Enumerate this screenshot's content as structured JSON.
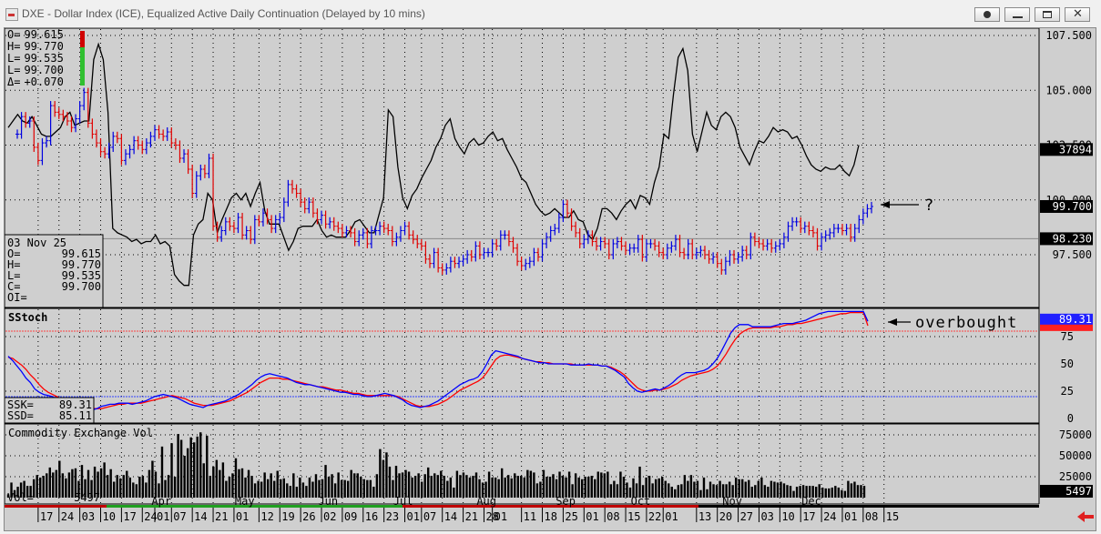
{
  "window": {
    "title": "DXE - Dollar Index (ICE), Equalized Active Daily Continuation (Delayed by 10 mins)"
  },
  "ohlc_readout": [
    {
      "k": "O=",
      "v": "99.615"
    },
    {
      "k": "H=",
      "v": "99.770"
    },
    {
      "k": "L=",
      "v": "99.535"
    },
    {
      "k": "L=",
      "v": "99.700"
    },
    {
      "k": "Δ=",
      "v": "+0.070"
    }
  ],
  "data_box": {
    "date": "03 Nov 25",
    "rows": [
      {
        "k": "O=",
        "v": "99.615"
      },
      {
        "k": "H=",
        "v": "99.770"
      },
      {
        "k": "L=",
        "v": "99.535"
      },
      {
        "k": "C=",
        "v": "99.700"
      },
      {
        "k": "OI=",
        "v": ""
      }
    ]
  },
  "price_panel": {
    "axis_ticks": [
      "107.500",
      "105.000",
      "102.500",
      "100.000",
      "97.500"
    ],
    "axis_tick_values": [
      107.5,
      105.0,
      102.5,
      100.0,
      97.5
    ],
    "tags": [
      {
        "text": "37894",
        "value": 102.3,
        "bg": "#000000",
        "fg": "#ffffff"
      },
      {
        "text": "99.700",
        "value": 99.7,
        "bg": "#000000",
        "fg": "#ffffff"
      },
      {
        "text": "98.230",
        "value": 98.23,
        "bg": "#000000",
        "fg": "#ffffff"
      }
    ],
    "annotation": "?"
  },
  "stoch_panel": {
    "title": "SStoch",
    "axis_ticks": [
      "75",
      "50",
      "25",
      "0"
    ],
    "axis_tick_values": [
      75,
      50,
      25,
      0
    ],
    "tag_top": "89.31",
    "annotation": "overbought",
    "ssk_label": "SSK=",
    "ssk_value": "89.31",
    "ssd_label": "SSD=",
    "ssd_value": "85.11"
  },
  "vol_panel": {
    "title": "Commodity Exchange Vol",
    "axis_ticks": [
      "75000",
      "50000",
      "25000"
    ],
    "axis_tick_values": [
      75000,
      50000,
      25000
    ],
    "tag": "5497",
    "vol_label": "Vol=",
    "vol_value": "5497"
  },
  "date_axis": {
    "months": [
      {
        "label": "Apr",
        "i": 32
      },
      {
        "label": "May",
        "i": 52
      },
      {
        "label": "Jun",
        "i": 72
      },
      {
        "label": "Jul",
        "i": 90
      },
      {
        "label": "Aug",
        "i": 110
      },
      {
        "label": "Sep",
        "i": 129
      },
      {
        "label": "Oct",
        "i": 147
      },
      {
        "label": "Nov",
        "i": 169
      },
      {
        "label": "Dec",
        "i": 188
      }
    ],
    "days": [
      {
        "label": "17",
        "i": 5
      },
      {
        "label": "24",
        "i": 10
      },
      {
        "label": "03",
        "i": 15
      },
      {
        "label": "10",
        "i": 20
      },
      {
        "label": "17",
        "i": 25
      },
      {
        "label": "24",
        "i": 30
      },
      {
        "label": "01",
        "i": 33
      },
      {
        "label": "07",
        "i": 37
      },
      {
        "label": "14",
        "i": 42
      },
      {
        "label": "21",
        "i": 47
      },
      {
        "label": "01",
        "i": 52
      },
      {
        "label": "12",
        "i": 58
      },
      {
        "label": "19",
        "i": 63
      },
      {
        "label": "26",
        "i": 68
      },
      {
        "label": "02",
        "i": 73
      },
      {
        "label": "09",
        "i": 78
      },
      {
        "label": "16",
        "i": 83
      },
      {
        "label": "23",
        "i": 88
      },
      {
        "label": "01",
        "i": 93
      },
      {
        "label": "07",
        "i": 97
      },
      {
        "label": "14",
        "i": 102
      },
      {
        "label": "21",
        "i": 107
      },
      {
        "label": "28",
        "i": 112
      },
      {
        "label": "01",
        "i": 114
      },
      {
        "label": "11",
        "i": 121
      },
      {
        "label": "18",
        "i": 126
      },
      {
        "label": "25",
        "i": 131
      },
      {
        "label": "01",
        "i": 136
      },
      {
        "label": "08",
        "i": 141
      },
      {
        "label": "15",
        "i": 146
      },
      {
        "label": "22",
        "i": 151
      },
      {
        "label": "01",
        "i": 155
      },
      {
        "label": "13",
        "i": 163
      },
      {
        "label": "20",
        "i": 168
      },
      {
        "label": "27",
        "i": 173
      },
      {
        "label": "03",
        "i": 178
      },
      {
        "label": "10",
        "i": 183
      },
      {
        "label": "17",
        "i": 188
      },
      {
        "label": "24",
        "i": 193
      },
      {
        "label": "01",
        "i": 198
      },
      {
        "label": "08",
        "i": 203
      },
      {
        "label": "15",
        "i": 208
      }
    ]
  },
  "chart_data": {
    "type": "line",
    "colors": {
      "up": "#0000e0",
      "down": "#e00000",
      "line": "#000000",
      "ssk": "#0000ff",
      "ssd": "#ff0000",
      "volume": "#000000"
    },
    "overbought_level": 80,
    "oversold_level": 20,
    "ref_price": 98.23,
    "closes": [
      103.0,
      103.8,
      103.5,
      103.6,
      102.4,
      101.8,
      102.6,
      102.7,
      104.3,
      104.0,
      103.9,
      103.8,
      103.6,
      103.3,
      103.7,
      104.3,
      104.9,
      103.5,
      103.0,
      102.6,
      102.2,
      102.1,
      102.4,
      102.9,
      102.8,
      101.8,
      102.1,
      102.3,
      102.7,
      102.5,
      102.3,
      102.6,
      102.9,
      103.2,
      103.0,
      102.9,
      103.1,
      102.6,
      102.5,
      101.9,
      102.1,
      101.4,
      100.3,
      101.1,
      101.4,
      101.2,
      101.9,
      98.8,
      98.3,
      98.6,
      99.0,
      98.8,
      98.7,
      99.2,
      98.4,
      98.6,
      98.2,
      99.1,
      99.0,
      99.4,
      99.1,
      98.7,
      99.1,
      99.2,
      99.9,
      100.7,
      100.5,
      100.3,
      99.9,
      99.6,
      99.9,
      99.4,
      99.1,
      99.3,
      98.9,
      99.0,
      98.8,
      98.7,
      98.5,
      98.6,
      98.5,
      98.1,
      98.4,
      98.5,
      98.0,
      98.6,
      98.6,
      98.8,
      98.7,
      98.6,
      98.1,
      98.3,
      98.6,
      98.8,
      98.4,
      98.2,
      98.0,
      97.9,
      97.3,
      97.1,
      97.6,
      96.9,
      96.8,
      96.9,
      97.2,
      97.1,
      97.2,
      97.3,
      97.5,
      97.4,
      97.9,
      97.5,
      97.6,
      97.6,
      98.0,
      97.9,
      98.4,
      98.4,
      98.1,
      97.8,
      97.2,
      97.0,
      97.1,
      97.2,
      97.6,
      97.4,
      98.0,
      98.3,
      98.6,
      98.7,
      99.2,
      99.8,
      99.4,
      98.8,
      98.5,
      98.0,
      98.2,
      98.4,
      98.1,
      97.9,
      98.1,
      98.0,
      97.5,
      98.0,
      98.1,
      97.9,
      97.7,
      97.8,
      97.8,
      98.2,
      97.4,
      98.0,
      98.0,
      97.9,
      97.6,
      97.5,
      97.8,
      97.9,
      98.2,
      97.6,
      97.5,
      98.0,
      97.5,
      97.6,
      97.7,
      97.5,
      97.3,
      97.4,
      97.1,
      96.8,
      97.2,
      97.5,
      97.3,
      97.4,
      97.7,
      97.5,
      98.3,
      98.1,
      98.0,
      97.9,
      98.0,
      97.8,
      97.9,
      98.0,
      98.3,
      98.8,
      99.0,
      99.0,
      98.7,
      98.8,
      98.6,
      98.5,
      97.9,
      98.3,
      98.4,
      98.5,
      98.7,
      98.7,
      98.6,
      98.7,
      98.3,
      98.7,
      99.1,
      99.4,
      99.6,
      99.7
    ],
    "ohlc_range_half": 0.35,
    "line_series": [
      103.3,
      103.6,
      103.9,
      103.6,
      103.5,
      103.8,
      103.4,
      103.0,
      102.9,
      102.9,
      103.1,
      103.3,
      103.8,
      104.0,
      103.4,
      103.5,
      103.6,
      103.6,
      106.4,
      107.1,
      106.4,
      104.0,
      98.7,
      98.5,
      98.4,
      98.3,
      98.1,
      98.2,
      98.0,
      98.1,
      98.1,
      98.4,
      98.0,
      98.1,
      97.9,
      96.6,
      96.3,
      96.1,
      96.1,
      98.4,
      98.9,
      99.1,
      100.3,
      100.0,
      98.5,
      99.1,
      99.6,
      100.1,
      100.3,
      100.0,
      100.3,
      99.7,
      100.3,
      100.8,
      99.5,
      98.9,
      98.9,
      98.9,
      98.3,
      97.7,
      98.1,
      98.7,
      98.8,
      98.8,
      98.8,
      99.1,
      98.6,
      98.3,
      98.4,
      98.3,
      98.3,
      98.3,
      98.6,
      99.0,
      99.1,
      98.8,
      98.5,
      98.5,
      99.3,
      100.1,
      104.1,
      103.8,
      101.5,
      100.1,
      99.6,
      100.2,
      100.5,
      101.0,
      101.4,
      101.8,
      102.4,
      102.8,
      103.4,
      103.7,
      102.8,
      102.4,
      102.1,
      102.6,
      102.8,
      102.5,
      102.6,
      102.9,
      103.1,
      102.7,
      102.8,
      102.3,
      101.9,
      101.5,
      101.0,
      100.8,
      100.3,
      99.8,
      99.5,
      99.3,
      99.4,
      99.6,
      99.4,
      99.2,
      99.2,
      99.5,
      99.1,
      99.0,
      98.4,
      98.2,
      98.7,
      99.6,
      99.6,
      99.4,
      99.1,
      99.5,
      99.8,
      100.0,
      99.6,
      100.2,
      100.1,
      99.8,
      100.8,
      101.5,
      103.0,
      102.8,
      104.8,
      106.5,
      106.9,
      105.9,
      103.0,
      102.2,
      103.1,
      104.0,
      103.4,
      103.2,
      103.8,
      104.0,
      103.8,
      103.3,
      102.4,
      102.0,
      101.6,
      102.2,
      102.7,
      102.6,
      102.9,
      103.3,
      103.1,
      103.2,
      103.1,
      102.8,
      102.9,
      102.5,
      102.0,
      101.6,
      101.4,
      101.3,
      101.5,
      101.4,
      101.4,
      101.6,
      101.3,
      101.1,
      101.6,
      102.5
    ],
    "ssk": [
      57,
      53,
      48,
      43,
      37,
      33,
      27,
      24,
      22,
      21,
      20,
      18,
      16,
      15,
      12,
      11,
      11,
      10,
      9,
      8,
      9,
      11,
      12,
      13,
      13,
      14,
      14,
      14,
      13,
      14,
      15,
      16,
      18,
      20,
      21,
      22,
      21,
      20,
      19,
      17,
      15,
      13,
      12,
      11,
      10,
      12,
      13,
      14,
      15,
      16,
      18,
      20,
      22,
      25,
      28,
      31,
      35,
      38,
      40,
      41,
      40,
      39,
      38,
      37,
      35,
      33,
      32,
      31,
      31,
      30,
      29,
      28,
      27,
      26,
      25,
      24,
      24,
      23,
      22,
      22,
      21,
      20,
      20,
      21,
      22,
      23,
      22,
      21,
      19,
      17,
      14,
      12,
      11,
      10,
      11,
      12,
      14,
      16,
      19,
      22,
      25,
      28,
      31,
      33,
      35,
      36,
      38,
      43,
      50,
      58,
      62,
      61,
      60,
      59,
      58,
      57,
      55,
      54,
      53,
      52,
      51,
      51,
      50,
      50,
      50,
      50,
      50,
      49,
      49,
      49,
      49,
      50,
      49,
      49,
      48,
      48,
      46,
      44,
      41,
      38,
      32,
      28,
      25,
      24,
      25,
      26,
      27,
      26,
      28,
      30,
      33,
      37,
      40,
      42,
      42,
      42,
      43,
      44,
      46,
      50,
      55,
      62,
      70,
      78,
      83,
      86,
      86,
      86,
      84,
      84,
      84,
      84,
      84,
      85,
      86,
      87,
      87,
      87,
      88,
      89,
      90,
      92,
      94,
      96,
      97,
      98,
      98,
      98,
      98,
      98,
      98,
      98,
      98,
      98,
      89
    ],
    "ssd": [
      56,
      55,
      52,
      49,
      45,
      40,
      36,
      31,
      27,
      24,
      22,
      20,
      18,
      17,
      15,
      13,
      12,
      11,
      10,
      9,
      9,
      9,
      10,
      11,
      12,
      13,
      13,
      14,
      14,
      14,
      14,
      15,
      16,
      17,
      18,
      19,
      20,
      21,
      20,
      19,
      18,
      16,
      14,
      13,
      12,
      12,
      12,
      13,
      14,
      15,
      16,
      18,
      20,
      22,
      24,
      27,
      30,
      33,
      35,
      37,
      37,
      37,
      36,
      36,
      35,
      34,
      33,
      32,
      31,
      30,
      29,
      29,
      28,
      27,
      26,
      26,
      25,
      24,
      23,
      23,
      22,
      21,
      21,
      21,
      21,
      21,
      21,
      21,
      20,
      18,
      16,
      14,
      12,
      11,
      11,
      11,
      12,
      13,
      15,
      17,
      20,
      23,
      26,
      28,
      30,
      32,
      34,
      37,
      42,
      48,
      54,
      57,
      58,
      58,
      57,
      56,
      55,
      54,
      53,
      52,
      52,
      51,
      51,
      50,
      50,
      50,
      50,
      50,
      49,
      49,
      49,
      49,
      49,
      49,
      48,
      48,
      47,
      45,
      43,
      40,
      36,
      32,
      28,
      26,
      25,
      25,
      26,
      26,
      27,
      28,
      30,
      32,
      35,
      37,
      39,
      40,
      41,
      42,
      43,
      45,
      48,
      53,
      59,
      66,
      72,
      77,
      80,
      82,
      83,
      83,
      83,
      83,
      83,
      84,
      84,
      85,
      86,
      86,
      87,
      87,
      88,
      89,
      90,
      91,
      92,
      93,
      94,
      95,
      96,
      96,
      97,
      97,
      97,
      97,
      85
    ],
    "volume": [
      4,
      18,
      9,
      13,
      18,
      20,
      14,
      14,
      22,
      27,
      24,
      26,
      29,
      36,
      30,
      33,
      44,
      29,
      23,
      30,
      34,
      35,
      20,
      39,
      22,
      33,
      21,
      37,
      31,
      35,
      42,
      27,
      34,
      19,
      27,
      23,
      27,
      32,
      24,
      18,
      16,
      25,
      26,
      18,
      33,
      44,
      31,
      17,
      61,
      21,
      27,
      65,
      25,
      76,
      69,
      50,
      59,
      72,
      66,
      73,
      78,
      41,
      74,
      26,
      37,
      45,
      33,
      42,
      20,
      25,
      29,
      47,
      34,
      35,
      24,
      33,
      26,
      17,
      20,
      19,
      30,
      22,
      29,
      20,
      32,
      22,
      23,
      17,
      14,
      29,
      13,
      24,
      18,
      14,
      24,
      19,
      28,
      21,
      22,
      39,
      25,
      28,
      17,
      30,
      21,
      21,
      20,
      33,
      29,
      29,
      25,
      22,
      21,
      21,
      13,
      28,
      58,
      45,
      54,
      37,
      21,
      38,
      29,
      30,
      33,
      31,
      24,
      26,
      29,
      19,
      28,
      36,
      26,
      29,
      27,
      32,
      26,
      20,
      24,
      12,
      32,
      27,
      30,
      27,
      24,
      26,
      30,
      22,
      18,
      19,
      31,
      24,
      24,
      22,
      35,
      24,
      27,
      23,
      29,
      26,
      26,
      24,
      33,
      32,
      30,
      17,
      19,
      33,
      25,
      25,
      28,
      22,
      31,
      26,
      24,
      31,
      16,
      29,
      24,
      22,
      25,
      25,
      26,
      22,
      31,
      30,
      29,
      31,
      16,
      20,
      16,
      31,
      25,
      18,
      12,
      23,
      17,
      37,
      15,
      24,
      26,
      17,
      22,
      23,
      25,
      20,
      17,
      13,
      10,
      15,
      16,
      27,
      20,
      27,
      19,
      20,
      9,
      24,
      10,
      19,
      16,
      15,
      20,
      16,
      16,
      19,
      15,
      24,
      22,
      22,
      19,
      21,
      13,
      15,
      20,
      24,
      15,
      13,
      20,
      19,
      18,
      19,
      17,
      15,
      14,
      8,
      13,
      14,
      15,
      14,
      14,
      14,
      13,
      16,
      12,
      11,
      11,
      12,
      14,
      12,
      9,
      8,
      20,
      17,
      19,
      15,
      15,
      14
    ]
  }
}
